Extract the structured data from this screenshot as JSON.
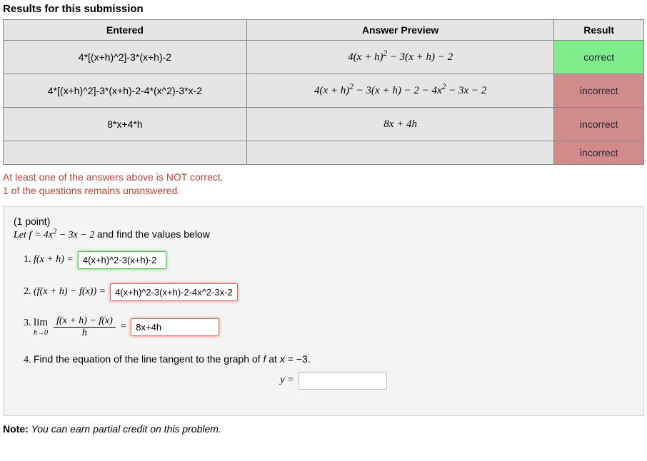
{
  "title": "Results for this submission",
  "headers": {
    "entered": "Entered",
    "preview": "Answer Preview",
    "result": "Result"
  },
  "rows": [
    {
      "entered": "4*[(x+h)^2]-3*(x+h)-2",
      "preview_html": "4(<i>x</i> + <i>h</i>)<sup>2</sup> − 3(<i>x</i> + <i>h</i>) − 2",
      "result": "correct",
      "ok": true
    },
    {
      "entered": "4*[(x+h)^2]-3*(x+h)-2-4*(x^2)-3*x-2",
      "preview_html": "4(<i>x</i> + <i>h</i>)<sup>2</sup> − 3(<i>x</i> + <i>h</i>) − 2 − 4<i>x</i><sup>2</sup> − 3<i>x</i> − 2",
      "result": "incorrect",
      "ok": false
    },
    {
      "entered": "8*x+4*h",
      "preview_html": "8<i>x</i> + 4<i>h</i>",
      "result": "incorrect",
      "ok": false
    },
    {
      "entered": "",
      "preview_html": "",
      "result": "incorrect",
      "ok": false
    }
  ],
  "error1": "At least one of the answers above is NOT correct.",
  "error2": "1 of the questions remains unanswered.",
  "points": "(1 point)",
  "let_html": "Let <i>f</i> = 4<i>x</i><sup>2</sup> − 3<i>x</i> − 2 <span style=\"font-family:Arial,sans-serif;font-style:normal\">and find the values below</span>",
  "q1": {
    "lhs_html": "<i>f</i>(<i>x</i> + <i>h</i>) =",
    "ans": "4(x+h)^2-3(x+h)-2",
    "status": "correct"
  },
  "q2": {
    "lhs_html": "(<i>f</i>(<i>x</i> + <i>h</i>) − <i>f</i>(<i>x</i>)) =",
    "ans": "4(x+h)^2-3(x+h)-2-4x^2-3x-2",
    "status": "incorrect"
  },
  "q3": {
    "num_html": "<i>f</i>(<i>x</i> + <i>h</i>) − <i>f</i>(<i>x</i>)",
    "den_html": "<i>h</i>",
    "limbot_html": "<i>h</i>→0",
    "ans": "8x+4h",
    "status": "incorrect"
  },
  "q4": {
    "text_html": "Find the equation of the line tangent to the graph of <i>f</i> at <i>x</i> = −3.",
    "lhs_html": "<i>y</i> =",
    "ans": "",
    "status": "none"
  },
  "note_bold": "Note:",
  "note_ital": "You can earn partial credit on this problem."
}
